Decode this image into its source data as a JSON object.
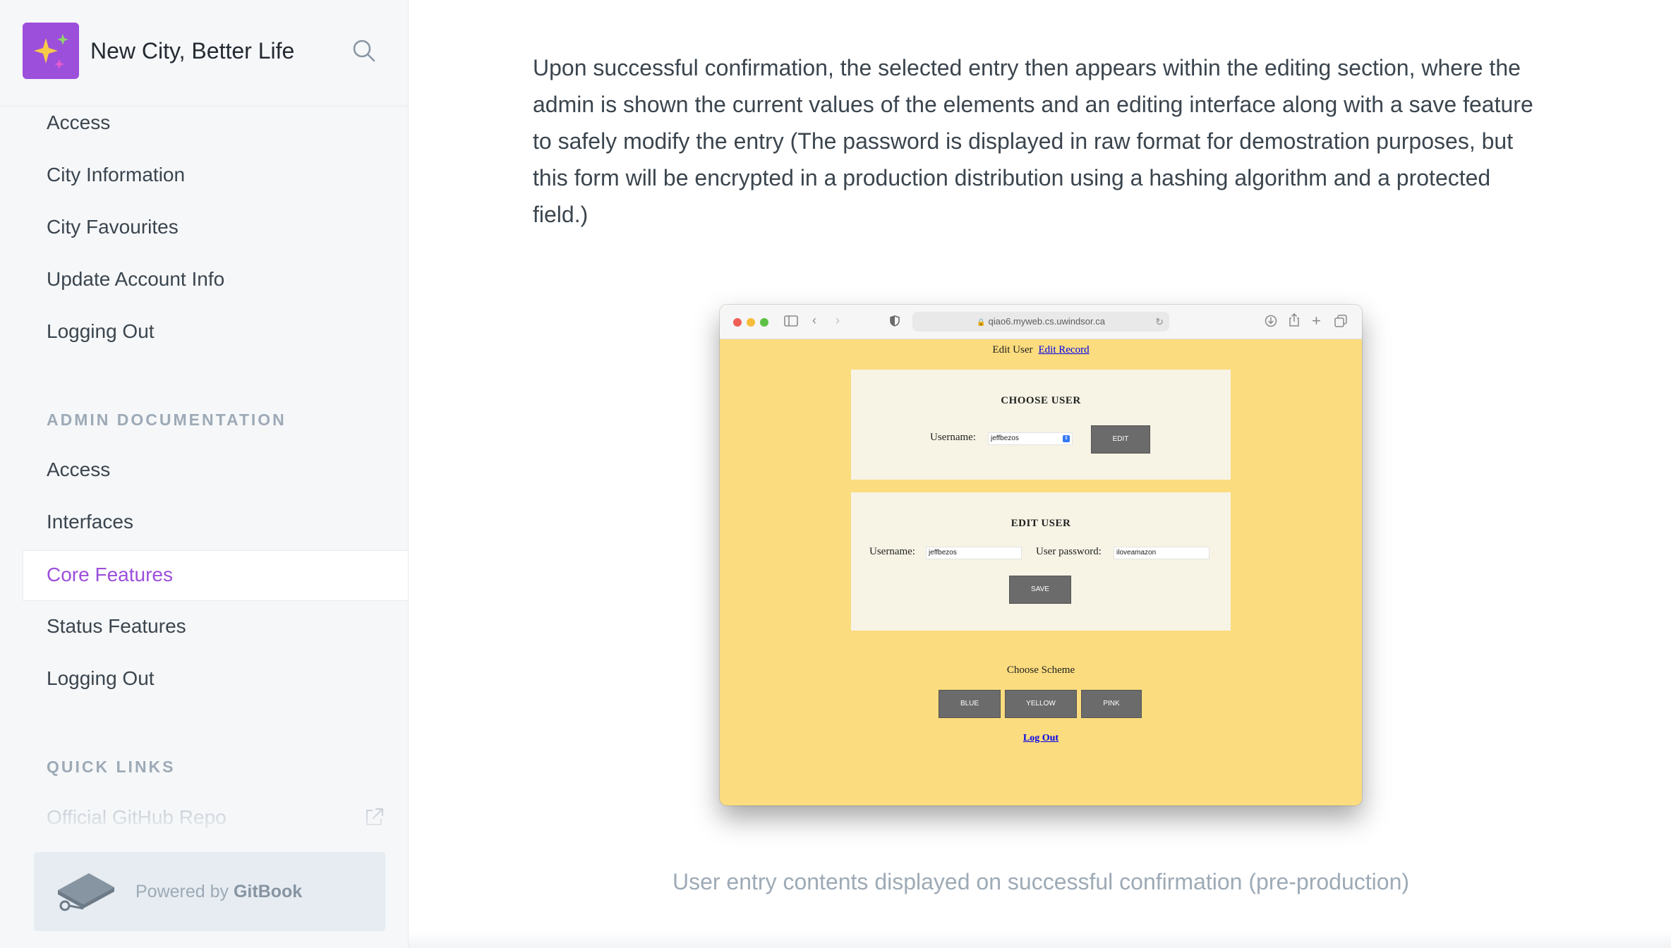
{
  "sidebar": {
    "brand_title": "New City, Better Life",
    "search_icon": "search-icon",
    "top_items": [
      "Access",
      "City Information",
      "City Favourites",
      "Update Account Info",
      "Logging Out"
    ],
    "admin_section_title": "ADMIN DOCUMENTATION",
    "admin_items": [
      "Access",
      "Interfaces",
      "Core Features",
      "Status Features",
      "Logging Out"
    ],
    "active_item": "Core Features",
    "quick_links_title": "QUICK LINKS",
    "quick_link": "Official GitHub Repo",
    "powered_prefix": "Powered by",
    "powered_brand": "GitBook"
  },
  "main": {
    "paragraph": "Upon successful confirmation, the selected entry then appears within the editing section, where the admin is shown the current values of the elements and an editing interface along with a save feature to safely modify the entry (The password is displayed in raw format for demostration purposes, but this form will be encrypted in a production distribution using a hashing algorithm and a protected field.)",
    "caption": "User entry contents displayed on successful confirmation (pre-production)"
  },
  "screenshot": {
    "url": "qiao6.myweb.cs.uwindsor.ca",
    "nav_text": "Edit User",
    "nav_link": "Edit Record",
    "choose_user_title": "CHOOSE USER",
    "choose_username_label": "Username:",
    "choose_username_value": "jeffbezos",
    "edit_button": "EDIT",
    "edit_user_title": "EDIT USER",
    "edit_username_label": "Username:",
    "edit_username_value": "jeffbezos",
    "edit_password_label": "User password:",
    "edit_password_value": "iloveamazon",
    "save_button": "SAVE",
    "scheme_title": "Choose Scheme",
    "scheme_buttons": [
      "BLUE",
      "YELLOW",
      "PINK"
    ],
    "logout_link": "Log Out",
    "background_color": "#fbdc7e"
  },
  "colors": {
    "accent": "#9c4fdb",
    "sidebar_bg": "#f5f7f9",
    "muted_text": "#9daab6"
  }
}
